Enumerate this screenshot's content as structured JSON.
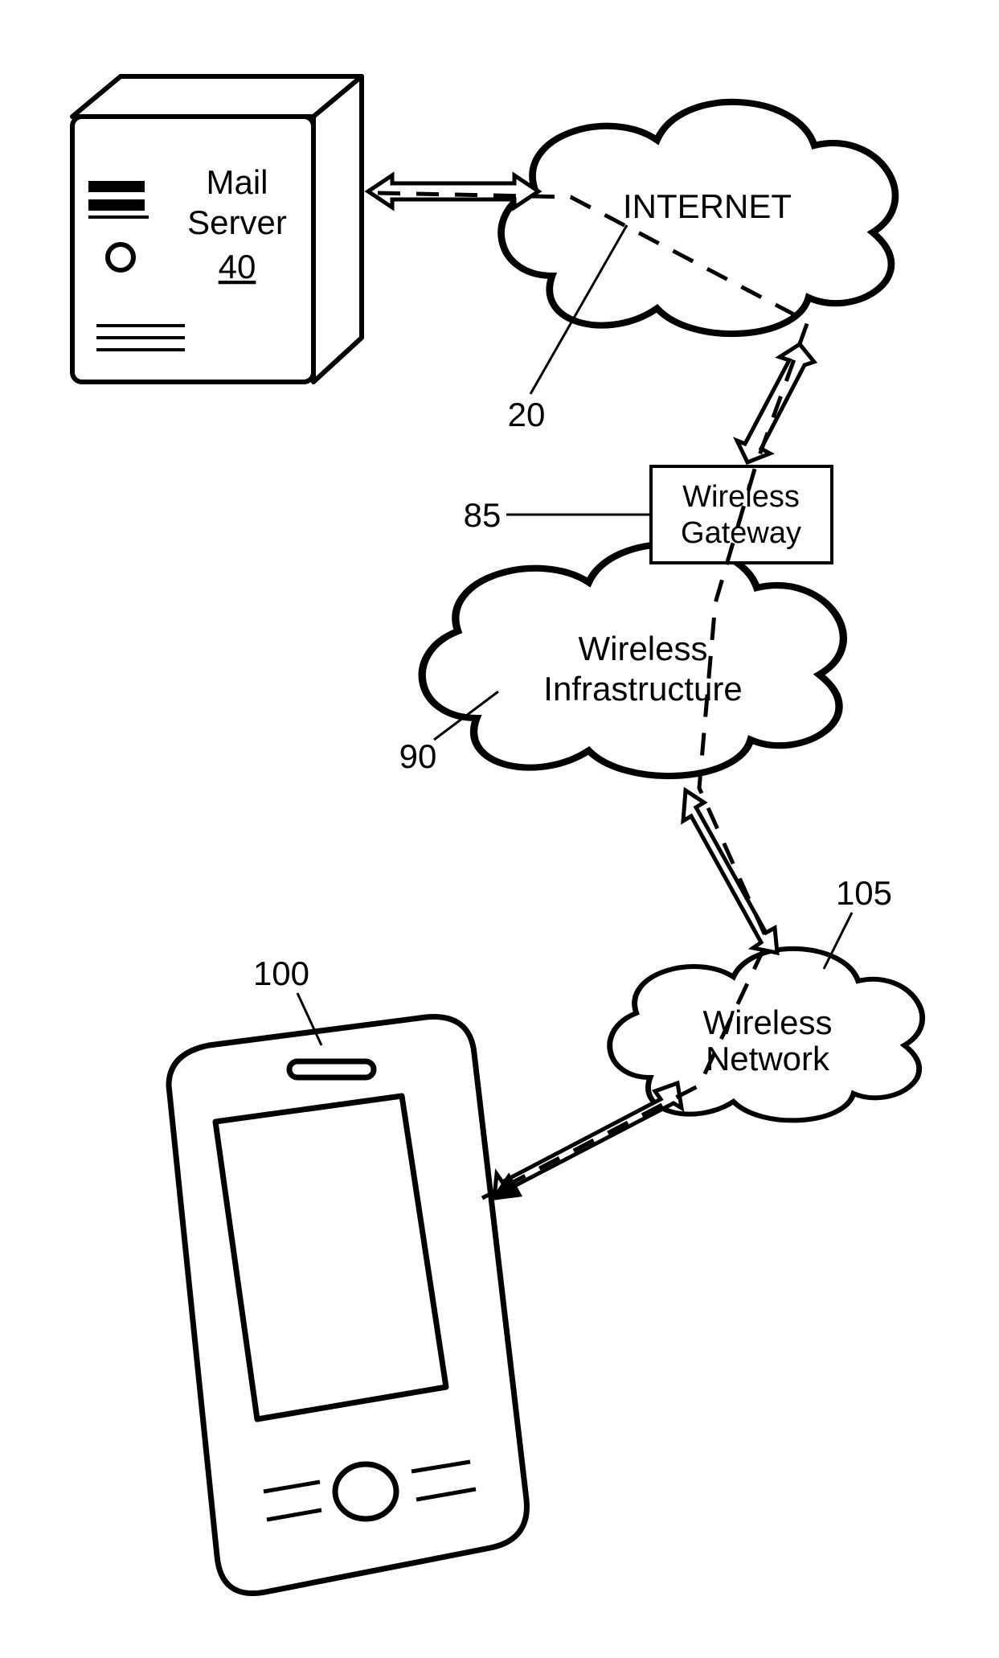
{
  "nodes": {
    "mail_server": {
      "label1": "Mail",
      "label2": "Server",
      "ref": "40"
    },
    "internet": {
      "label": "INTERNET",
      "ref": "20"
    },
    "gateway": {
      "label1": "Wireless",
      "label2": "Gateway",
      "ref": "85"
    },
    "infrastructure": {
      "label1": "Wireless",
      "label2": "Infrastructure",
      "ref": "90"
    },
    "wireless_net": {
      "label1": "Wireless",
      "label2": "Network",
      "ref": "105"
    },
    "device": {
      "ref": "100"
    }
  }
}
